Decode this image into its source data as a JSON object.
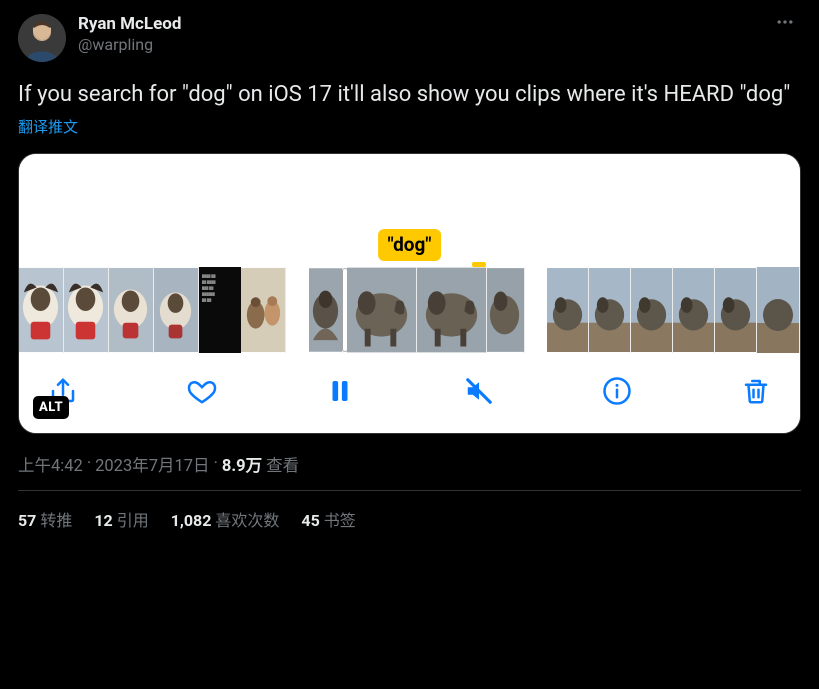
{
  "author": {
    "display_name": "Ryan McLeod",
    "handle": "@warpling"
  },
  "tweet_text": "If you search for \"dog\" on iOS 17 it'll also show you clips where it's HEARD \"dog\"",
  "translate_label": "翻译推文",
  "media": {
    "search_label": "\"dog\"",
    "alt_badge": "ALT",
    "controls": {
      "share": "share-icon",
      "like": "heart-icon",
      "pause": "pause-icon",
      "mute": "mute-icon",
      "info": "info-icon",
      "trash": "trash-icon"
    }
  },
  "meta": {
    "time": "上午4:42",
    "dot1": " · ",
    "date": "2023年7月17日",
    "dot2": " · ",
    "views_num": "8.9万",
    "views_label": " 查看"
  },
  "stats": {
    "retweets_num": "57",
    "retweets_label": "转推",
    "quotes_num": "12",
    "quotes_label": "引用",
    "likes_num": "1,082",
    "likes_label": "喜欢次数",
    "bookmarks_num": "45",
    "bookmarks_label": "书签"
  }
}
